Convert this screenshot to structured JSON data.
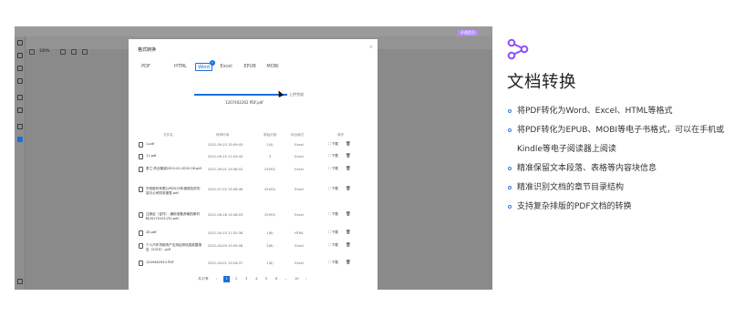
{
  "app": {
    "zoom": "100%",
    "vip_label": "开通会员"
  },
  "dialog": {
    "title": "格式转换",
    "close": "×",
    "tabs": [
      "PDF",
      "HTML",
      "Word",
      "Excel",
      "EPUB",
      "MOBI"
    ],
    "active_tab": "Word",
    "upload_label": "上传完成",
    "upload_progress": 1.0,
    "uploaded_file": "1207402262 PDF.pdf",
    "columns": [
      "文件名",
      "转换时间",
      "原始页数",
      "转出格式",
      "操作"
    ],
    "rows": [
      {
        "name": "1.pdf",
        "time": "2021-09-15 15:09:43",
        "pages": "2(4)",
        "format": "Excel"
      },
      {
        "name": "11.pdf",
        "time": "2021-09-15 11:20:43",
        "pages": "3",
        "format": "Excel"
      },
      {
        "name": "泰兰·药业集团2020-01-2020 08.pdf",
        "time": "2021-09-01 15:38:03",
        "pages": "23(93)",
        "format": "Excel"
      },
      {
        "name": "华西股份有限公司2020年度报告的内容与公司财务报表.pdf",
        "time": "2021-07-02 15:08:46",
        "pages": "43(93)",
        "format": "Excel"
      },
      {
        "name": "注册证（证件）-通用准备资格档案材料20170101132.pdf",
        "time": "2021-06-18 14:36:03",
        "pages": "29(93)",
        "format": "Excel"
      },
      {
        "name": "28.pdf",
        "time": "2021-04-15 17:32:38",
        "pages": "1(6)",
        "format": "HTML"
      },
      {
        "name": "个人汽车贷款资产支持证券信息披露报告（2019）.pdf",
        "time": "2021-04-09 15:00:08",
        "pages": "3(6)",
        "format": "Excel"
      },
      {
        "name": "1209462924 PDF",
        "time": "2021-04-01 15:18:37",
        "pages": "1(6)",
        "format": "Excel"
      }
    ],
    "download_label": "下载",
    "pager": {
      "total": "共37条",
      "prev": "‹",
      "pages": [
        "1",
        "2",
        "3",
        "4",
        "5",
        "6",
        "...",
        "10"
      ],
      "current": "1",
      "next": "›"
    }
  },
  "panel": {
    "title": "文档转换",
    "accent": "#3a7ae0",
    "logo_color": "#8a4fff",
    "bullets": [
      {
        "line1": "将PDF转化为Word、Excel、HTML等格式"
      },
      {
        "line1": "将PDF转化为EPUB、MOBI等电子书格式，可以在手机或",
        "line2": "Kindle等电子阅读器上阅读"
      },
      {
        "line1": "精准保留文本段落、表格等内容块信息"
      },
      {
        "line1": "精准识别文档的章节目录结构"
      },
      {
        "line1": "支持复杂排版的PDF文档的转换"
      }
    ]
  }
}
